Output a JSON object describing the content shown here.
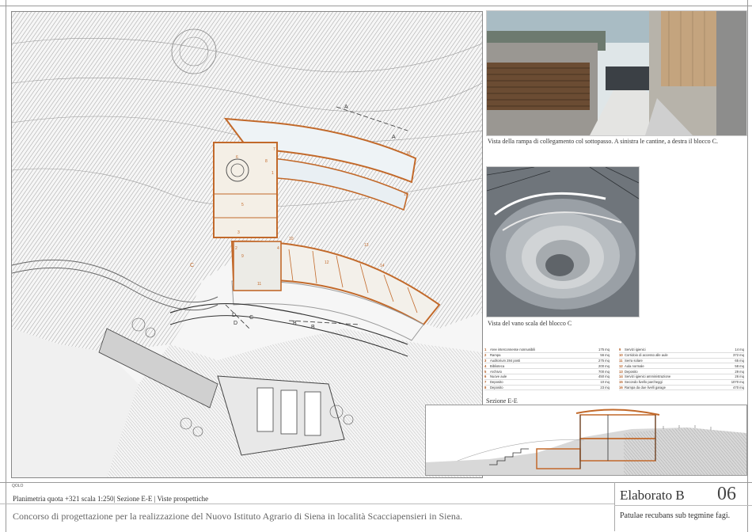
{
  "renders": {
    "top_caption": "Vista della rampa di collegamento col sottopasso. A sinistra le cantine, a destra il blocco C.",
    "middle_caption": "Vista del vano scala del blocco C"
  },
  "plan": {
    "section_labels": [
      "A",
      "A",
      "B",
      "B",
      "C",
      "C",
      "D",
      "D"
    ],
    "room_numbers": [
      "1",
      "2",
      "3",
      "4",
      "5",
      "6",
      "7",
      "8",
      "9",
      "10",
      "11",
      "12",
      "13",
      "14",
      "15",
      "16"
    ]
  },
  "legend": {
    "left": [
      {
        "num": "1",
        "label": "Aree interconnesse nonnusibili",
        "area": "175 mq"
      },
      {
        "num": "2",
        "label": "Rampa",
        "area": "56 mq"
      },
      {
        "num": "3",
        "label": "Auditorium 284 posti",
        "area": "275 mq"
      },
      {
        "num": "4",
        "label": "Biblioteca",
        "area": "200 mq"
      },
      {
        "num": "5",
        "label": "Archivio",
        "area": "700 mq"
      },
      {
        "num": "6",
        "label": "Nuove aule",
        "area": "450 mq"
      },
      {
        "num": "7",
        "label": "Deposito",
        "area": "10 mq"
      },
      {
        "num": "8",
        "label": "Deposito",
        "area": "23 mq"
      }
    ],
    "right": [
      {
        "num": "9",
        "label": "Servizi igienici",
        "area": "14 mq"
      },
      {
        "num": "10",
        "label": "Corridoio di accesso alle aule",
        "area": "372 mq"
      },
      {
        "num": "11",
        "label": "Serra solare",
        "area": "65 mq"
      },
      {
        "num": "12",
        "label": "Aula normale",
        "area": "58 mq"
      },
      {
        "num": "13",
        "label": "Deposito",
        "area": "29 mq"
      },
      {
        "num": "14",
        "label": "Servizi igienici amministrazione",
        "area": "26 mq"
      },
      {
        "num": "15",
        "label": "Secondo livello parcheggi",
        "area": "1070 mq"
      },
      {
        "num": "16",
        "label": "Rampa da due livelli garage",
        "area": "470 mq"
      }
    ]
  },
  "section": {
    "title": "Sezione E-E"
  },
  "title_block": {
    "logo": "QOLO",
    "subtitle": "Planimetria quota +321 scala 1:250| Sezione E-E | Viste prospettiche",
    "title": "Concorso di progettazione per la realizzazione del Nuovo Istituto Agrario di Siena in località Scacciapensieri in Siena.",
    "elaborato": "Elaborato B",
    "number": "06",
    "motto": "Patulae recubans sub tegmine fagi."
  },
  "colors": {
    "accent": "#c2692a",
    "line": "#555555",
    "frame": "#999999"
  }
}
